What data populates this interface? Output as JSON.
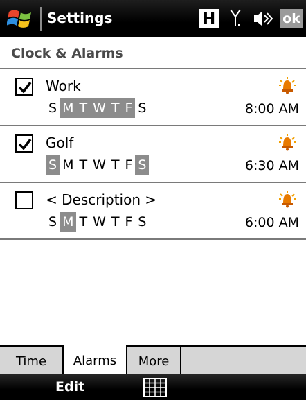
{
  "titlebar": {
    "title": "Settings",
    "h_indicator": "H",
    "ok_label": "ok",
    "icons": [
      "windows-logo-icon",
      "h-network-icon",
      "signal-icon",
      "speaker-icon"
    ]
  },
  "header": {
    "title": "Clock & Alarms"
  },
  "alarms": [
    {
      "description": "Work",
      "enabled": true,
      "time": "8:00 AM",
      "days": [
        {
          "label": "S",
          "on": false
        },
        {
          "label": "M",
          "on": true
        },
        {
          "label": "T",
          "on": true
        },
        {
          "label": "W",
          "on": true
        },
        {
          "label": "T",
          "on": true
        },
        {
          "label": "F",
          "on": true
        },
        {
          "label": "S",
          "on": false
        }
      ]
    },
    {
      "description": "Golf",
      "enabled": true,
      "time": "6:30 AM",
      "days": [
        {
          "label": "S",
          "on": true
        },
        {
          "label": "M",
          "on": false
        },
        {
          "label": "T",
          "on": false
        },
        {
          "label": "W",
          "on": false
        },
        {
          "label": "T",
          "on": false
        },
        {
          "label": "F",
          "on": false
        },
        {
          "label": "S",
          "on": true
        }
      ]
    },
    {
      "description": "< Description >",
      "enabled": false,
      "time": "6:00 AM",
      "days": [
        {
          "label": "S",
          "on": false
        },
        {
          "label": "M",
          "on": true
        },
        {
          "label": "T",
          "on": false
        },
        {
          "label": "W",
          "on": false
        },
        {
          "label": "T",
          "on": false
        },
        {
          "label": "F",
          "on": false
        },
        {
          "label": "S",
          "on": false
        }
      ]
    }
  ],
  "tabs": [
    {
      "label": "Time",
      "active": false
    },
    {
      "label": "Alarms",
      "active": true
    },
    {
      "label": "More",
      "active": false
    }
  ],
  "softkeys": {
    "left": "Edit",
    "center_icon": "keyboard-icon"
  },
  "colors": {
    "day_on_bg": "#8c8c8c",
    "bell": "#e87a00",
    "titlebar_bg": "#000000"
  }
}
